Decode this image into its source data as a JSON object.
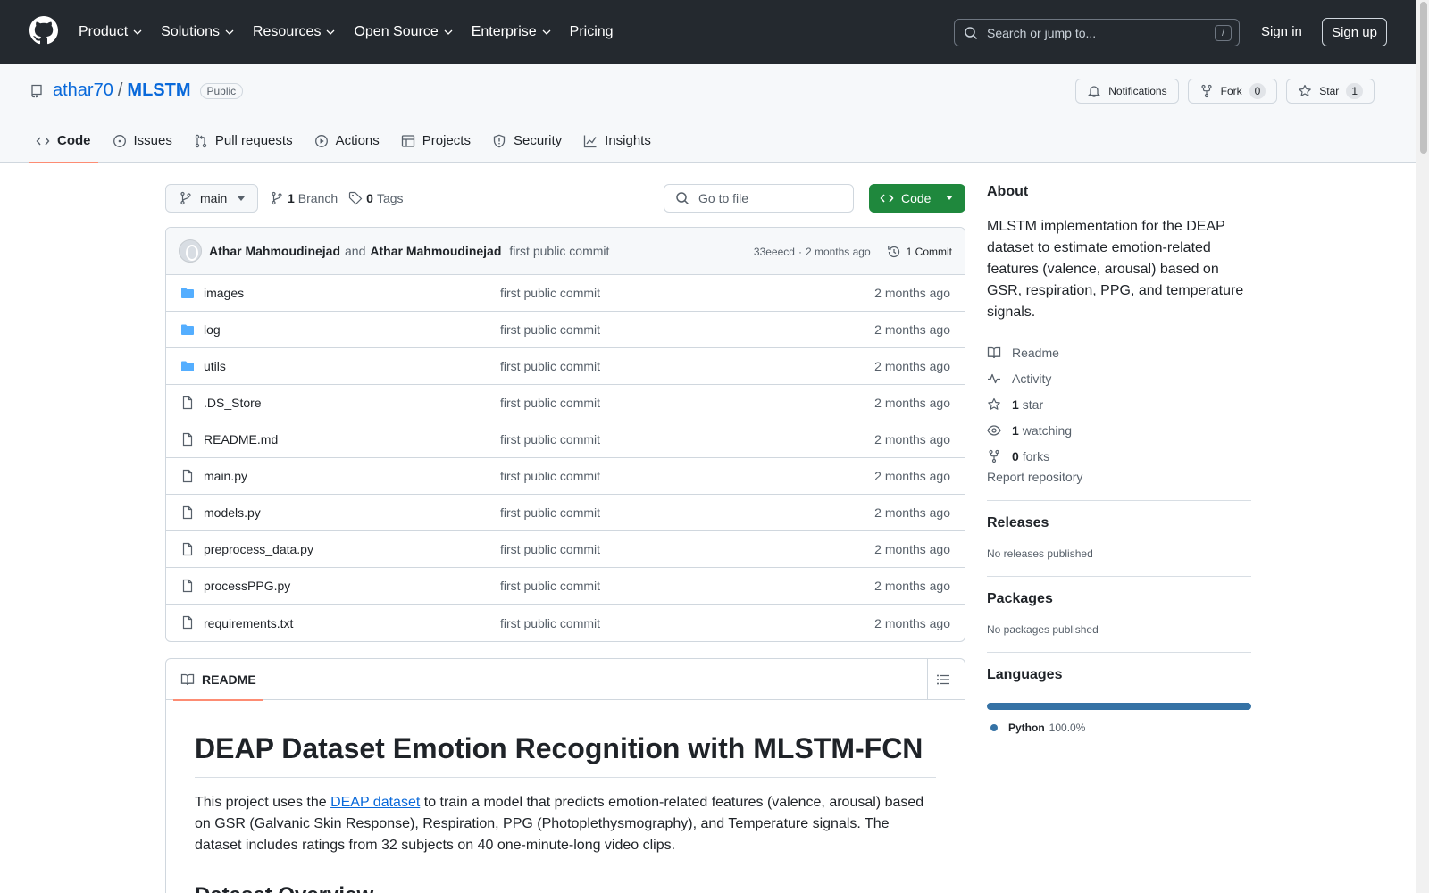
{
  "header": {
    "nav": [
      {
        "label": "Product",
        "dropdown": true
      },
      {
        "label": "Solutions",
        "dropdown": true
      },
      {
        "label": "Resources",
        "dropdown": true
      },
      {
        "label": "Open Source",
        "dropdown": true
      },
      {
        "label": "Enterprise",
        "dropdown": true
      },
      {
        "label": "Pricing",
        "dropdown": false
      }
    ],
    "search_placeholder": "Search or jump to...",
    "search_shortcut": "/",
    "sign_in": "Sign in",
    "sign_up": "Sign up"
  },
  "repo": {
    "owner": "athar70",
    "separator": "/",
    "name": "MLSTM",
    "visibility": "Public",
    "notifications_label": "Notifications",
    "fork_label": "Fork",
    "fork_count": "0",
    "star_label": "Star",
    "star_count": "1"
  },
  "tabs": [
    {
      "label": "Code",
      "icon": "code-icon",
      "active": true
    },
    {
      "label": "Issues",
      "icon": "issue-icon",
      "active": false
    },
    {
      "label": "Pull requests",
      "icon": "pull-request-icon",
      "active": false
    },
    {
      "label": "Actions",
      "icon": "play-icon",
      "active": false
    },
    {
      "label": "Projects",
      "icon": "table-icon",
      "active": false
    },
    {
      "label": "Security",
      "icon": "shield-icon",
      "active": false
    },
    {
      "label": "Insights",
      "icon": "graph-icon",
      "active": false
    }
  ],
  "branchbar": {
    "branch": "main",
    "branch_count": "1",
    "branch_label": "Branch",
    "tag_count": "0",
    "tag_label": "Tags",
    "goto_placeholder": "Go to file",
    "code_button": "Code"
  },
  "latest_commit": {
    "author1": "Athar Mahmoudinejad",
    "and": "and",
    "author2": "Athar Mahmoudinejad",
    "message": "first public commit",
    "hash": "33eeecd",
    "dot": "·",
    "age": "2 months ago",
    "commit_count_label": "1 Commit"
  },
  "files": [
    {
      "name": "images",
      "type": "folder",
      "message": "first public commit",
      "age": "2 months ago"
    },
    {
      "name": "log",
      "type": "folder",
      "message": "first public commit",
      "age": "2 months ago"
    },
    {
      "name": "utils",
      "type": "folder",
      "message": "first public commit",
      "age": "2 months ago"
    },
    {
      "name": ".DS_Store",
      "type": "file",
      "message": "first public commit",
      "age": "2 months ago"
    },
    {
      "name": "README.md",
      "type": "file",
      "message": "first public commit",
      "age": "2 months ago"
    },
    {
      "name": "main.py",
      "type": "file",
      "message": "first public commit",
      "age": "2 months ago"
    },
    {
      "name": "models.py",
      "type": "file",
      "message": "first public commit",
      "age": "2 months ago"
    },
    {
      "name": "preprocess_data.py",
      "type": "file",
      "message": "first public commit",
      "age": "2 months ago"
    },
    {
      "name": "processPPG.py",
      "type": "file",
      "message": "first public commit",
      "age": "2 months ago"
    },
    {
      "name": "requirements.txt",
      "type": "file",
      "message": "first public commit",
      "age": "2 months ago"
    }
  ],
  "readme": {
    "tab_label": "README",
    "title": "DEAP Dataset Emotion Recognition with MLSTM-FCN",
    "p1_before": "This project uses the ",
    "p1_link": "DEAP dataset",
    "p1_after": " to train a model that predicts emotion-related features (valence, arousal) based on GSR (Galvanic Skin Response), Respiration, PPG (Photoplethysmography), and Temperature signals. The dataset includes ratings from 32 subjects on 40 one-minute-long video clips.",
    "h2": "Dataset Overview"
  },
  "sidebar": {
    "about_title": "About",
    "description": "MLSTM implementation for the DEAP dataset to estimate emotion-related features (valence, arousal) based on GSR, respiration, PPG, and temperature signals.",
    "links": [
      {
        "icon": "book-icon",
        "count": "",
        "label": "Readme"
      },
      {
        "icon": "pulse-icon",
        "count": "",
        "label": "Activity"
      },
      {
        "icon": "star-icon",
        "count": "1",
        "label": "star"
      },
      {
        "icon": "eye-icon",
        "count": "1",
        "label": "watching"
      },
      {
        "icon": "fork-icon",
        "count": "0",
        "label": "forks"
      }
    ],
    "report": "Report repository",
    "releases_title": "Releases",
    "releases_empty": "No releases published",
    "packages_title": "Packages",
    "packages_empty": "No packages published",
    "languages_title": "Languages",
    "languages": [
      {
        "name": "Python",
        "percent": "100.0%",
        "color": "#3572A5",
        "fraction": 1.0
      }
    ]
  },
  "colors": {
    "header_bg": "#24292f",
    "link": "#0969da",
    "primary_button": "#1f883d",
    "active_tab_underline": "#fd8c73",
    "folder_icon": "#54aeff"
  }
}
